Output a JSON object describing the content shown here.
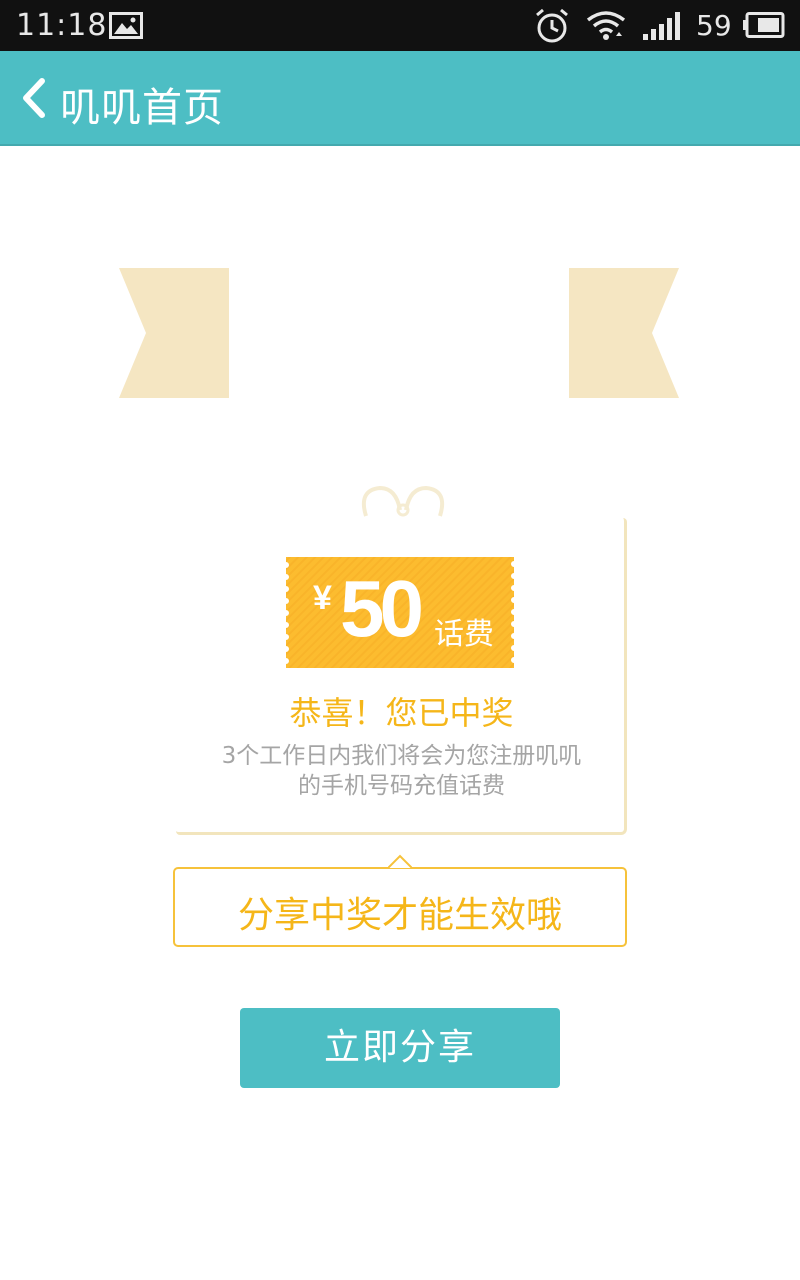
{
  "status_bar": {
    "time": "11:18",
    "battery_level": "59",
    "icons": [
      "picture-icon",
      "alarm-icon",
      "wifi-icon",
      "signal-icon",
      "battery-icon"
    ]
  },
  "header": {
    "title": "叽叽首页",
    "back_icon": "chevron-left-icon"
  },
  "prize": {
    "currency": "¥",
    "amount": "50",
    "unit": "话费",
    "congrats": "恭喜！您已中奖",
    "description_line1": "3个工作日内我们将会为您注册叽叽",
    "description_line2": "的手机号码充值话费"
  },
  "share_hint": "分享中奖才能生效哦",
  "share_button": "立即分享",
  "colors": {
    "teal": "#4dbec4",
    "gold": "#f5b619",
    "coupon": "#fcbc2f",
    "ribbon": "#f5e6c2",
    "gray_text": "#a5a5a5"
  }
}
